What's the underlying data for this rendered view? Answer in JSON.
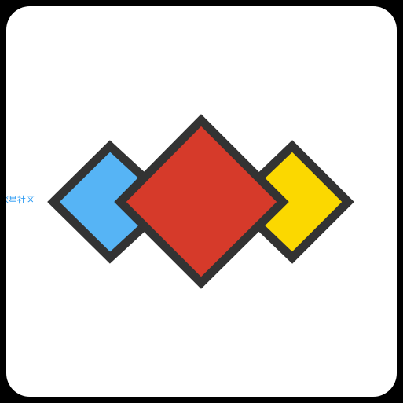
{
  "app_icon": {
    "name_label": "探星社区",
    "tile_color": "#ffffff",
    "outline_color": "#333333",
    "shapes": [
      {
        "name": "blue-diamond",
        "color": "#56b4f5"
      },
      {
        "name": "yellow-diamond",
        "color": "#fbd800"
      },
      {
        "name": "red-diamond",
        "color": "#d63a2a"
      }
    ]
  }
}
